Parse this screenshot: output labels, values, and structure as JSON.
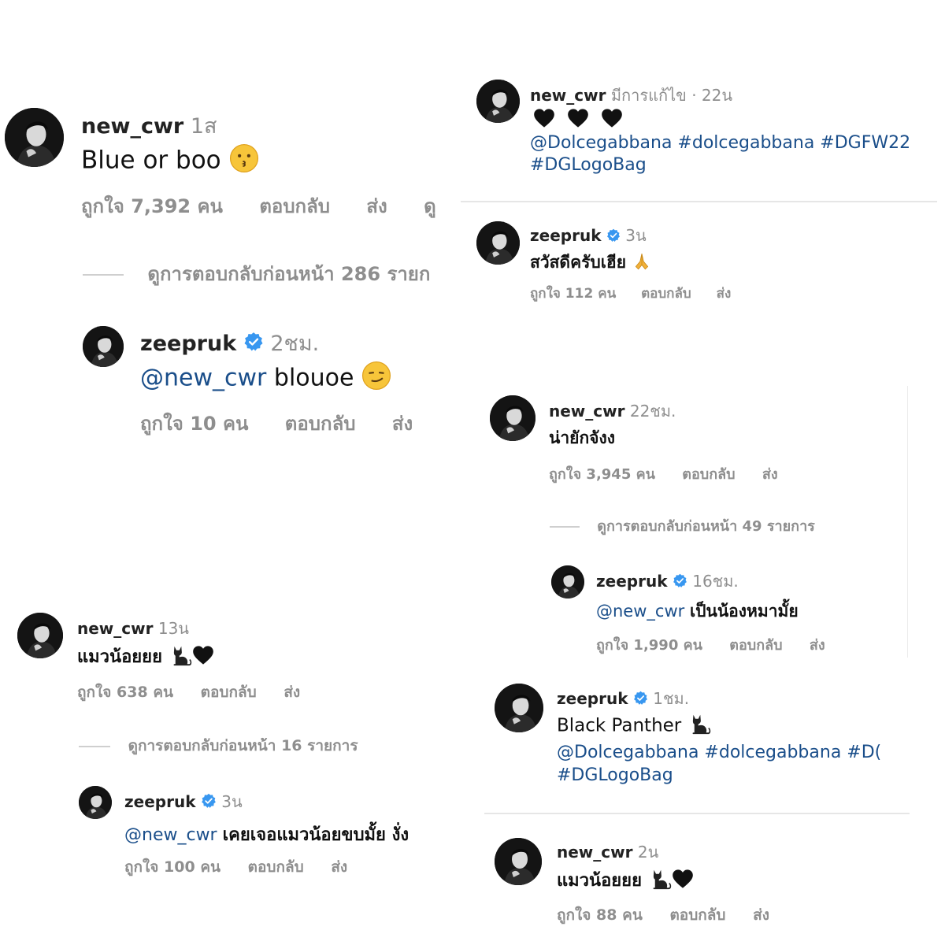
{
  "panel_a": {
    "comment": {
      "username": "new_cwr",
      "time": "1ส",
      "text": "Blue or boo",
      "emoji": "kissing-face",
      "actions": {
        "likes_prefix": "ถูกใจ",
        "likes_count": "7,392",
        "likes_suffix": "คน",
        "reply": "ตอบกลับ",
        "send": "ส่ง",
        "more": "ดู"
      }
    },
    "view_more": {
      "prefix": "ดูการตอบกลับก่อนหน้า",
      "count": "286",
      "suffix": "รายก"
    },
    "reply": {
      "username": "zeepruk",
      "time": "2ชม.",
      "mention": "@new_cwr",
      "text": "blouoe",
      "emoji": "smirking-face",
      "actions": {
        "likes_prefix": "ถูกใจ",
        "likes_count": "10",
        "likes_suffix": "คน",
        "reply": "ตอบกลับ",
        "send": "ส่ง"
      }
    }
  },
  "panel_b": {
    "comment": {
      "username": "new_cwr",
      "time": "13น",
      "text": "แมวน้อยยย",
      "emoji": "black-cat black-heart",
      "actions": {
        "likes_prefix": "ถูกใจ",
        "likes_count": "638",
        "likes_suffix": "คน",
        "reply": "ตอบกลับ",
        "send": "ส่ง"
      }
    },
    "view_more": {
      "prefix": "ดูการตอบกลับก่อนหน้า",
      "count": "16",
      "suffix": "รายการ"
    },
    "reply": {
      "username": "zeepruk",
      "time": "3น",
      "mention": "@new_cwr",
      "text": "เคยเจอแมวน้อยขบมั้ย งั่ง",
      "actions": {
        "likes_prefix": "ถูกใจ",
        "likes_count": "100",
        "likes_suffix": "คน",
        "reply": "ตอบกลับ",
        "send": "ส่ง"
      }
    }
  },
  "panel_c": {
    "post": {
      "username": "new_cwr",
      "edited": "มีการแก้ไข",
      "time": "22น",
      "hearts": "black-heart x3",
      "tags_line1": "@Dolcegabbana #dolcegabbana #DGFW22",
      "tags_line2": "#DGLogoBag"
    },
    "comment": {
      "username": "zeepruk",
      "time": "3น",
      "text": "สวัสดีครับเฮีย",
      "emoji": "folded-hands",
      "actions": {
        "likes_prefix": "ถูกใจ",
        "likes_count": "112",
        "likes_suffix": "คน",
        "reply": "ตอบกลับ",
        "send": "ส่ง"
      }
    }
  },
  "panel_d": {
    "comment": {
      "username": "new_cwr",
      "time": "22ชม.",
      "text": "น่ายักจังง",
      "actions": {
        "likes_prefix": "ถูกใจ",
        "likes_count": "3,945",
        "likes_suffix": "คน",
        "reply": "ตอบกลับ",
        "send": "ส่ง"
      }
    },
    "view_more": {
      "prefix": "ดูการตอบกลับก่อนหน้า",
      "count": "49",
      "suffix": "รายการ"
    },
    "reply": {
      "username": "zeepruk",
      "time": "16ชม.",
      "mention": "@new_cwr",
      "text": "เป็นน้องหมามั้ย",
      "actions": {
        "likes_prefix": "ถูกใจ",
        "likes_count": "1,990",
        "likes_suffix": "คน",
        "reply": "ตอบกลับ",
        "send": "ส่ง"
      }
    }
  },
  "panel_e": {
    "post": {
      "username": "zeepruk",
      "time": "1ชม.",
      "text": "Black Panther",
      "emoji": "black-cat",
      "tags_line1": "@Dolcegabbana #dolcegabbana #D(",
      "tags_line2": "#DGLogoBag"
    },
    "comment": {
      "username": "new_cwr",
      "time": "2น",
      "text": "แมวน้อยยย",
      "emoji": "black-cat black-heart",
      "actions": {
        "likes_prefix": "ถูกใจ",
        "likes_count": "88",
        "likes_suffix": "คน",
        "reply": "ตอบกลับ",
        "send": "ส่ง"
      }
    }
  },
  "colors": {
    "link": "#1a4e8a",
    "muted": "#8e8e8e",
    "verified": "#3897f0"
  }
}
